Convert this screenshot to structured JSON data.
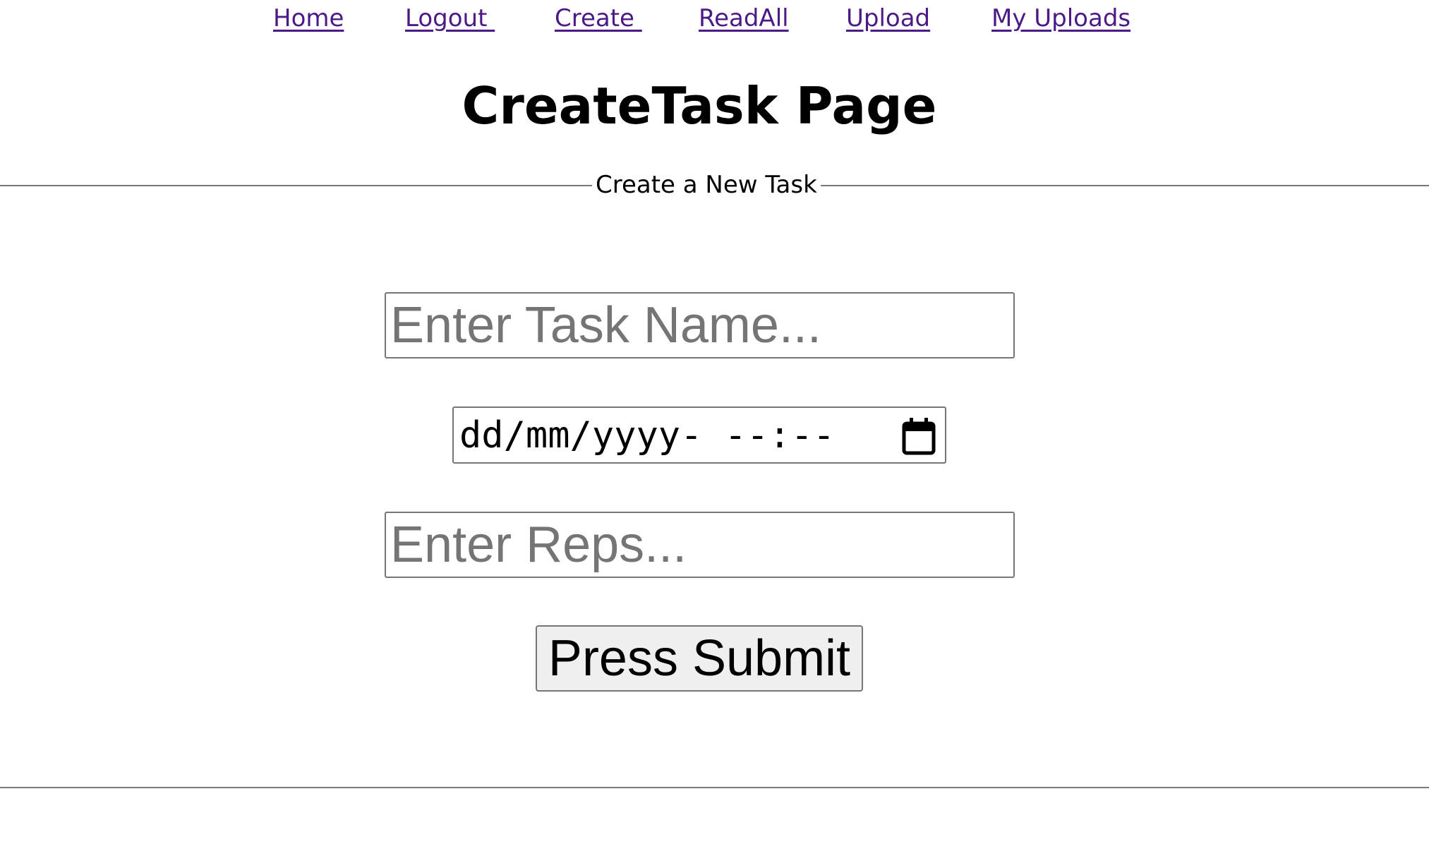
{
  "nav": {
    "links": [
      {
        "label": "Home"
      },
      {
        "label": "Logout "
      },
      {
        "label": "Create "
      },
      {
        "label": "ReadAll"
      },
      {
        "label": "Upload"
      },
      {
        "label": "My Uploads"
      }
    ]
  },
  "page": {
    "title": "CreateTask Page"
  },
  "form": {
    "legend": "Create a New Task",
    "task_name_placeholder": "Enter Task Name...",
    "datetime_placeholder": "dd/mm/yyyy- --:--",
    "reps_placeholder": "Enter Reps...",
    "submit_label": "Press Submit"
  },
  "colors": {
    "link": "#4b1a86",
    "border": "#767676",
    "button_bg": "#efefef",
    "placeholder": "#757575"
  },
  "icons": {
    "datetime_picker": "calendar-icon"
  }
}
